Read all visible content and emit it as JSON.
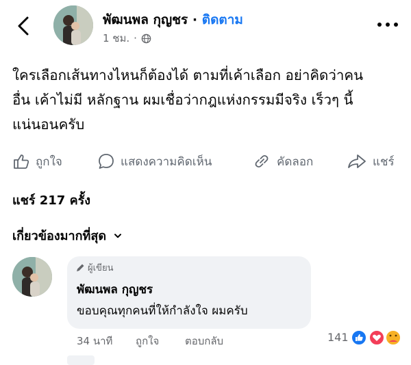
{
  "header": {
    "author_name": "พัฒนพล กุญชร",
    "separator": "·",
    "follow_label": "ติดตาม",
    "timestamp": "1 ชม.",
    "meta_dot": "·",
    "icons": [
      "back-icon",
      "globe-icon",
      "more-icon"
    ]
  },
  "post": {
    "lines": [
      "ใครเลือกเส้นทางไหนก็ต้องได้ ตามที่เค้าเลือก อย่าคิดว่าคน",
      "อื่น เค้าไม่มี หลักฐาน ผมเชื่อว่ากฎแห่งกรรมมีจริง เร็วๆ นี้",
      "แน่นอนครับ"
    ]
  },
  "actions": {
    "like_label": "ถูกใจ",
    "comment_label": "แสดงความคิดเห็น",
    "copy_label": "คัดลอก",
    "share_label": "แชร์"
  },
  "shares_text": "แชร์ 217 ครั้ง",
  "filter": {
    "label": "เกี่ยวข้องมากที่สุด"
  },
  "comment": {
    "badge_label": "ผู้เขียน",
    "author_name": "พัฒนพล กุญชร",
    "text": "ขอบคุณทุกคนที่ให้กำลังใจ ผมครับ",
    "time": "34 นาที",
    "like_label": "ถูกใจ",
    "reply_label": "ตอบกลับ",
    "reaction_count": "141",
    "reaction_icons": [
      "like-reaction-icon",
      "love-reaction-icon",
      "care-reaction-icon"
    ],
    "colors": {
      "like": "#1877f2",
      "love": "#f33e58",
      "care": "#f7b125"
    }
  }
}
